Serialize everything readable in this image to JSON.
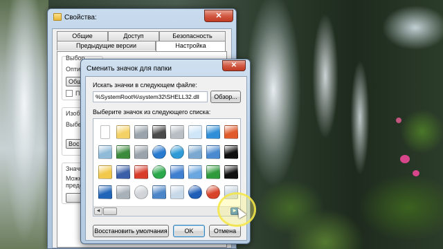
{
  "properties_window": {
    "title": "Свойства:",
    "close_glyph": "✕",
    "tabs_row1": [
      "Общие",
      "Доступ",
      "Безопасность"
    ],
    "tabs_row2": [
      "Предыдущие версии",
      "Настройка"
    ],
    "active_tab": "Настройка",
    "fragments": [
      "Выбор",
      "Опти",
      "Обще",
      "Пр",
      "Изобр",
      "Выбе",
      "Вос",
      "Значк",
      "Можн",
      "предс"
    ]
  },
  "dialog": {
    "title": "Сменить значок для папки",
    "close_glyph": "✕",
    "file_label": "Искать значки в следующем файле:",
    "file_value": "%SystemRoot%\\system32\\SHELL32.dll",
    "browse_label": "Обзор...",
    "list_label": "Выберите значок из следующего списка:",
    "restore_label": "Восстановить умолчания",
    "ok_label": "OK",
    "cancel_label": "Отмена"
  },
  "icons": [
    {
      "name": "blank-doc-icon",
      "color": "#ffffff"
    },
    {
      "name": "folder-icon",
      "color": "#f4d165"
    },
    {
      "name": "hard-drive-icon",
      "color": "#9aa3ab"
    },
    {
      "name": "chip-icon",
      "color": "#4a4a4a"
    },
    {
      "name": "printer-icon",
      "color": "#b8bec4"
    },
    {
      "name": "clock-doc-icon",
      "color": "#cfe6f8"
    },
    {
      "name": "display-icon",
      "color": "#2f8fd8"
    },
    {
      "name": "arrow-drive-icon",
      "color": "#e05a2a"
    },
    {
      "name": "recycle-bin-icon",
      "color": "#8fbad8"
    },
    {
      "name": "server-icon",
      "color": "#3c8a3c"
    },
    {
      "name": "network-drive-icon",
      "color": "#9aa3ab"
    },
    {
      "name": "globe-icon",
      "color": "#2a7bd0"
    },
    {
      "name": "globe-net-icon",
      "color": "#2e9bd6"
    },
    {
      "name": "network-computers-icon",
      "color": "#7aa8d0"
    },
    {
      "name": "window-settings-icon",
      "color": "#4a8ad0"
    },
    {
      "name": "shortcut-icon",
      "color": "#111111"
    },
    {
      "name": "folder-star-icon",
      "color": "#f2c94c"
    },
    {
      "name": "floppy-icon",
      "color": "#3a5fa8"
    },
    {
      "name": "drive-error-icon",
      "color": "#d83c2a"
    },
    {
      "name": "cd-drive-icon",
      "color": "#2aa84a"
    },
    {
      "name": "network-map-icon",
      "color": "#3f7fd0"
    },
    {
      "name": "magnifier-icon",
      "color": "#6aa6e0"
    },
    {
      "name": "green-arrow-icon",
      "color": "#2f9a3c"
    },
    {
      "name": "black-dot-icon",
      "color": "#111111"
    },
    {
      "name": "blue-screen-icon",
      "color": "#2165b8"
    },
    {
      "name": "drive-icon",
      "color": "#a8b0b8"
    },
    {
      "name": "clock-cd-icon",
      "color": "#d0d4d8"
    },
    {
      "name": "computer-icon",
      "color": "#4c86c8"
    },
    {
      "name": "calculator-icon",
      "color": "#c7d8e8"
    },
    {
      "name": "help-icon",
      "color": "#1f5fb8"
    },
    {
      "name": "power-icon",
      "color": "#d8442a"
    },
    {
      "name": "empty-bin-icon",
      "color": "#c9d6e0"
    },
    {
      "name": "folder-chart-icon",
      "color": "#f0c43a"
    }
  ],
  "scrollbar": {
    "left_glyph": "◀",
    "right_glyph": "▶",
    "thumb_glyph": "|||"
  }
}
